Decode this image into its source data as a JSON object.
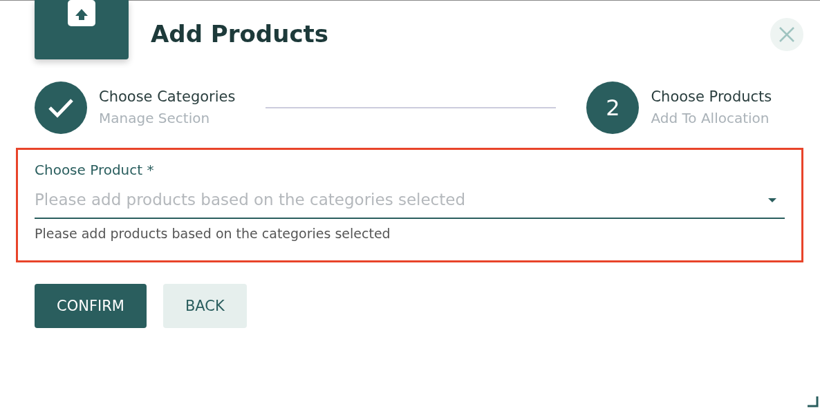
{
  "dialog": {
    "title": "Add Products"
  },
  "steps": [
    {
      "title": "Choose Categories",
      "subtitle": "Manage Section",
      "completed": true
    },
    {
      "title": "Choose Products",
      "subtitle": "Add To Allocation",
      "completed": false,
      "number": "2"
    }
  ],
  "product_field": {
    "label": "Choose Product *",
    "placeholder": "Please add products based on the categories selected",
    "helper": "Please add products based on the categories selected",
    "highlighted": true
  },
  "buttons": [
    {
      "label": "CONFIRM",
      "kind": "primary"
    },
    {
      "label": "BACK",
      "kind": "secondary"
    }
  ]
}
